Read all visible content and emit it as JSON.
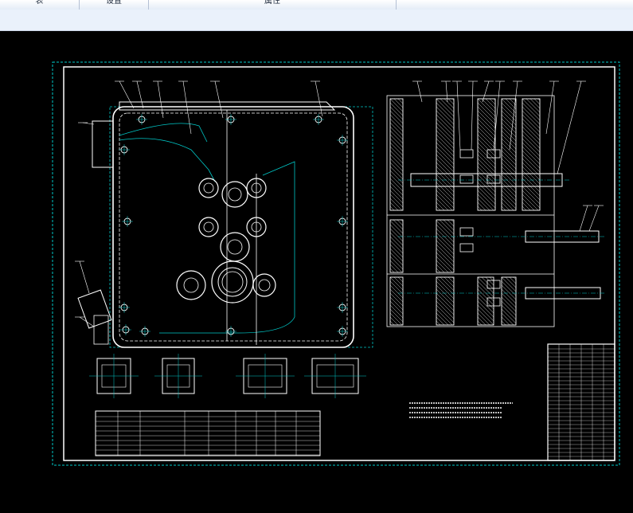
{
  "toolbar": {
    "tabs": [
      {
        "label": "表"
      },
      {
        "label": "设置"
      },
      {
        "label": "属性"
      }
    ]
  },
  "drawing": {
    "colors": {
      "background": "#000000",
      "lines": "#ffffff",
      "centerlines": "#00c8c8",
      "frame_dashed": "#00c8c8"
    },
    "callouts_left": [
      "1",
      "2",
      "3",
      "4",
      "5",
      "6",
      "7",
      "8",
      "9",
      "10",
      "11",
      "12"
    ],
    "callouts_right": [
      "13",
      "14",
      "15",
      "16",
      "17",
      "18",
      "19",
      "20",
      "21",
      "22",
      "23",
      "24"
    ],
    "icons": [
      "gear-icon",
      "bolt-icon",
      "shaft-icon",
      "bearing-icon"
    ]
  }
}
